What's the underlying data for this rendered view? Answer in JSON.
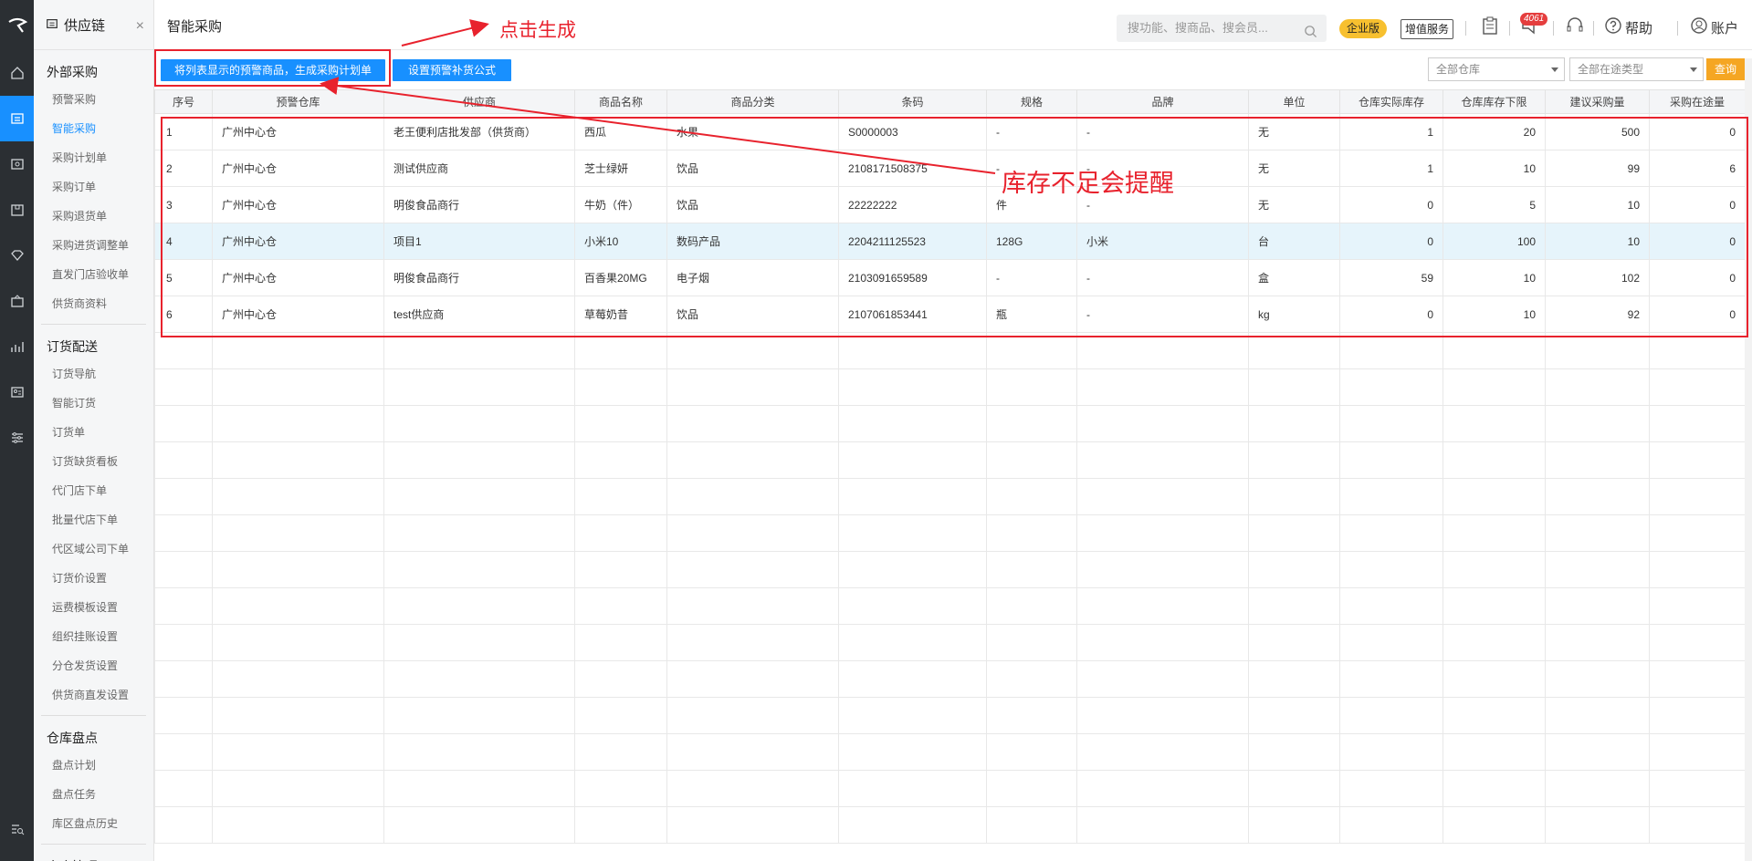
{
  "sidebar": {
    "title": "供应链",
    "close": "×",
    "groups": [
      {
        "title": "外部采购",
        "items": [
          "预警采购",
          "智能采购",
          "采购计划单",
          "采购订单",
          "采购退货单",
          "采购进货调整单",
          "直发门店验收单",
          "供货商资料"
        ]
      },
      {
        "title": "订货配送",
        "items": [
          "订货导航",
          "智能订货",
          "订货单",
          "订货缺货看板",
          "代门店下单",
          "批量代店下单",
          "代区域公司下单",
          "订货价设置",
          "运费模板设置",
          "组织挂账设置",
          "分仓发货设置",
          "供货商直发设置"
        ]
      },
      {
        "title": "仓库盘点",
        "items": [
          "盘点计划",
          "盘点任务",
          "库区盘点历史"
        ]
      },
      {
        "title": "仓库管理",
        "items": []
      }
    ],
    "active_item": "智能采购"
  },
  "header": {
    "title": "智能采购",
    "search_placeholder": "搜功能、搜商品、搜会员...",
    "enterprise_badge": "企业版",
    "value_service": "增值服务",
    "notify_count": "4061",
    "help": "帮助",
    "account": "账户"
  },
  "toolbar": {
    "generate_button": "将列表显示的预警商品，生成采购计划单",
    "formula_button": "设置预警补货公式",
    "warehouse_select": "全部仓库",
    "transit_select": "全部在途类型",
    "query_button": "查询"
  },
  "table": {
    "columns": [
      "序号",
      "预警仓库",
      "供应商",
      "商品名称",
      "商品分类",
      "条码",
      "规格",
      "品牌",
      "单位",
      "仓库实际库存",
      "仓库库存下限",
      "建议采购量",
      "采购在途量"
    ],
    "rows": [
      [
        "1",
        "广州中心仓",
        "老王便利店批发部（供货商）",
        "西瓜",
        "水果",
        "S0000003",
        "-",
        "-",
        "无",
        "1",
        "20",
        "500",
        "0"
      ],
      [
        "2",
        "广州中心仓",
        "测试供应商",
        "芝士绿妍",
        "饮品",
        "2108171508375",
        "-",
        "-",
        "无",
        "1",
        "10",
        "99",
        "6"
      ],
      [
        "3",
        "广州中心仓",
        "明俊食品商行",
        "牛奶（件）",
        "饮品",
        "22222222",
        "件",
        "-",
        "无",
        "0",
        "5",
        "10",
        "0"
      ],
      [
        "4",
        "广州中心仓",
        "项目1",
        "小米10",
        "数码产品",
        "2204211125523",
        "128G",
        "小米",
        "台",
        "0",
        "100",
        "10",
        "0"
      ],
      [
        "5",
        "广州中心仓",
        "明俊食品商行",
        "百香果20MG",
        "电子烟",
        "2103091659589",
        "-",
        "-",
        "盒",
        "59",
        "10",
        "102",
        "0"
      ],
      [
        "6",
        "广州中心仓",
        "test供应商",
        "草莓奶昔",
        "饮品",
        "2107061853441",
        "瓶",
        "-",
        "kg",
        "0",
        "10",
        "92",
        "0"
      ]
    ],
    "highlighted_row": 4
  },
  "annotations": {
    "click_generate": "点击生成",
    "stock_warning": "库存不足会提醒"
  },
  "colors": {
    "primary": "#1890ff",
    "accent_orange": "#f5a623",
    "annotation_red": "#e8222d",
    "rail_bg": "#2b2f33"
  }
}
